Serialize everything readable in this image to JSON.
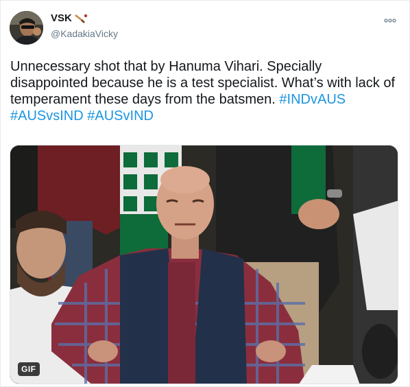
{
  "author": {
    "display_name": "VSK",
    "name_emoji_icon": "cricket-bat-icon",
    "handle": "@KadakiaVicky",
    "avatar_icon": "user-avatar"
  },
  "menu": {
    "icon": "more-options-icon"
  },
  "tweet": {
    "text": "Unnecessary shot that by Hanuma Vihari. Specially disappointed because he is a test specialist. What’s with lack of temperament these days from the batsmen.",
    "hashtags": [
      "#INDvAUS",
      "#AUSvsIND",
      "#AUSvIND"
    ]
  },
  "media": {
    "badge": "GIF",
    "colors": {
      "jersey_green": "#0e6b3a",
      "vest_navy": "#23304a",
      "shirt_check": "#8a2e3e",
      "skin": "#d6a287",
      "background": "#2b2a25"
    }
  },
  "colors": {
    "link": "#1b95e0",
    "text": "#14171a",
    "secondary": "#657786",
    "border": "#e6ecf0"
  }
}
